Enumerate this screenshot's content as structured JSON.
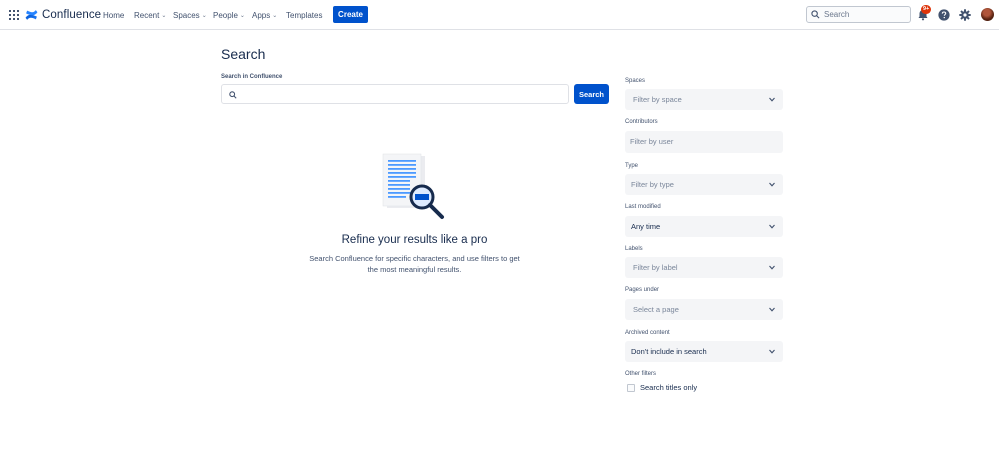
{
  "app": {
    "name": "Confluence"
  },
  "nav": {
    "home": "Home",
    "recent": "Recent",
    "spaces": "Spaces",
    "people": "People",
    "apps": "Apps",
    "templates": "Templates",
    "create": "Create",
    "search_placeholder": "Search",
    "notification_count": "9+"
  },
  "main": {
    "title": "Search",
    "search_label": "Search in Confluence",
    "search_value": "",
    "search_button": "Search",
    "empty_title": "Refine your results like a pro",
    "empty_desc_line1": "Search Confluence for specific characters, and use filters to get",
    "empty_desc_line2": "the most meaningful results."
  },
  "filters": {
    "spaces": {
      "label": "Spaces",
      "value": "Filter by space"
    },
    "contributors": {
      "label": "Contributors",
      "value": "Filter by user"
    },
    "type": {
      "label": "Type",
      "value": "Filter by type"
    },
    "last_modified": {
      "label": "Last modified",
      "value": "Any time"
    },
    "labels": {
      "label": "Labels",
      "value": "Filter by label"
    },
    "pages_under": {
      "label": "Pages under",
      "value": "Select a page"
    },
    "archived": {
      "label": "Archived content",
      "value": "Don't include in search"
    },
    "other": {
      "label": "Other filters",
      "titles_only": "Search titles only",
      "titles_only_checked": false
    }
  },
  "colors": {
    "brand": "#0052CC",
    "text": "#172B4D",
    "subtle_text": "#42526E",
    "field_bg": "#F4F5F7",
    "badge": "#DE350B"
  },
  "icons": [
    "app-switcher-icon",
    "confluence-logo-icon",
    "search-icon",
    "bell-icon",
    "help-icon",
    "gear-icon",
    "chevron-down-icon"
  ]
}
